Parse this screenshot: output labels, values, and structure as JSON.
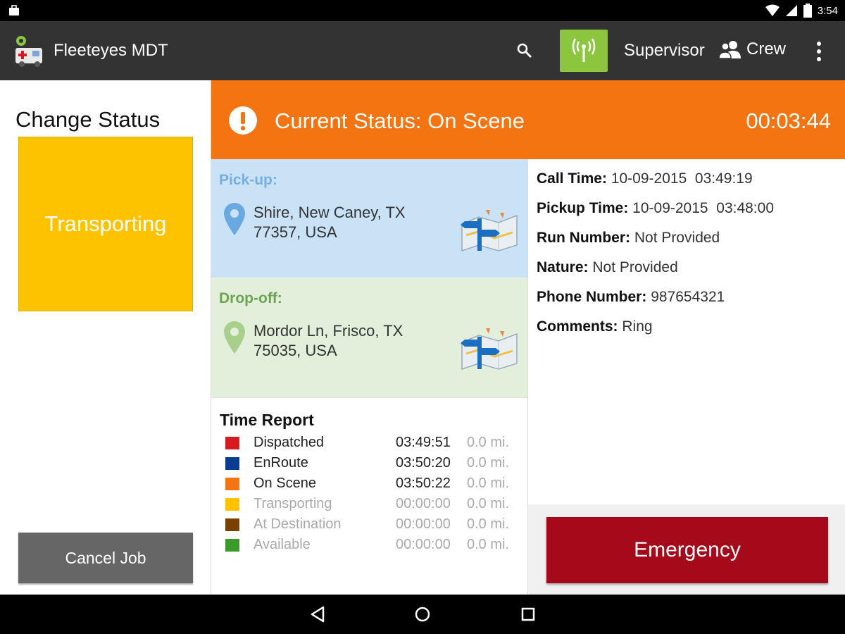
{
  "status_bar": {
    "time": "3:54",
    "icons": [
      "briefcase-icon",
      "wifi-icon",
      "signal-icon",
      "battery-icon"
    ]
  },
  "app_bar": {
    "title": "Fleeteyes MDT",
    "supervisor_label": "Supervisor",
    "crew_label": "Crew",
    "signal_button_color": "#8cc63f"
  },
  "left_panel": {
    "heading": "Change Status",
    "transport_button": "Transporting",
    "cancel_button": "Cancel Job"
  },
  "current_status": {
    "label": "Current Status: On Scene",
    "timer": "00:03:44",
    "color": "#f47411"
  },
  "pickup": {
    "label": "Pick-up:",
    "line1": "Shire, New Caney, TX",
    "line2": "77357, USA"
  },
  "dropoff": {
    "label": "Drop-off:",
    "line1": "Mordor Ln, Frisco, TX",
    "line2": "75035, USA"
  },
  "time_report": {
    "title": "Time Report",
    "rows": [
      {
        "label": "Dispatched",
        "time": "03:49:51",
        "distance": "0.0 mi.",
        "color": "#d71920",
        "active": true
      },
      {
        "label": "EnRoute",
        "time": "03:50:20",
        "distance": "0.0 mi.",
        "color": "#0a3d91",
        "active": true
      },
      {
        "label": "On Scene",
        "time": "03:50:22",
        "distance": "0.0 mi.",
        "color": "#f47411",
        "active": true
      },
      {
        "label": "Transporting",
        "time": "00:00:00",
        "distance": "0.0 mi.",
        "color": "#fdc300",
        "active": false
      },
      {
        "label": "At Destination",
        "time": "00:00:00",
        "distance": "0.0 mi.",
        "color": "#7b3f00",
        "active": false
      },
      {
        "label": "Available",
        "time": "00:00:00",
        "distance": "0.0 mi.",
        "color": "#3a9a2a",
        "active": false
      }
    ]
  },
  "details": {
    "call_time_label": "Call Time:",
    "call_time": "10-09-2015  03:49:19",
    "pickup_time_label": "Pickup Time:",
    "pickup_time": "10-09-2015  03:48:00",
    "run_number_label": "Run Number:",
    "run_number": "Not Provided",
    "nature_label": "Nature:",
    "nature": "Not Provided",
    "phone_label": "Phone Number:",
    "phone": "987654321",
    "comments_label": "Comments:",
    "comments": "Ring"
  },
  "emergency_button": "Emergency"
}
